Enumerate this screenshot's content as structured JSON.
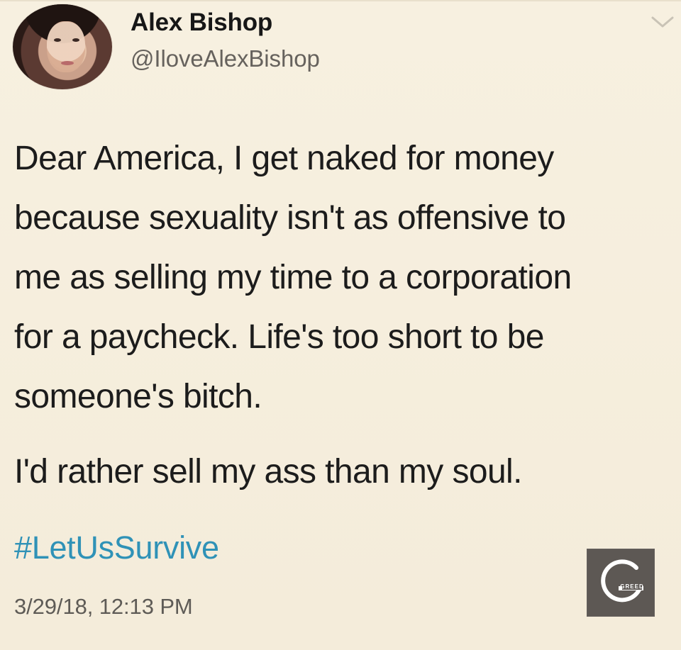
{
  "tweet": {
    "name": "Alex Bishop",
    "handle": "@IloveAlexBishop",
    "text": "Dear America, I get naked for money\nbecause sexuality isn't as offensive to\nme as selling my time to a corporation\nfor a paycheck. Life's too short to be\nsomeone's bitch.",
    "line2": "I'd rather sell my ass than my soul.",
    "hashtag": "#LetUsSurvive",
    "timestamp": "3/29/18, 12:13 PM"
  },
  "watermark": {
    "text": "GREED"
  },
  "colors": {
    "background": "#f6efdf",
    "name_text": "#171717",
    "handle_text": "#66625d",
    "body_text": "#1c1c1c",
    "hashtag": "#2f92b7",
    "timestamp": "#5e5b56",
    "logo_bg": "#5d5854",
    "logo_fg": "#ffffff"
  },
  "icons": {
    "menu": "chevron-down-icon",
    "avatar": "avatar-icon",
    "logo": "greed-logo-icon"
  }
}
